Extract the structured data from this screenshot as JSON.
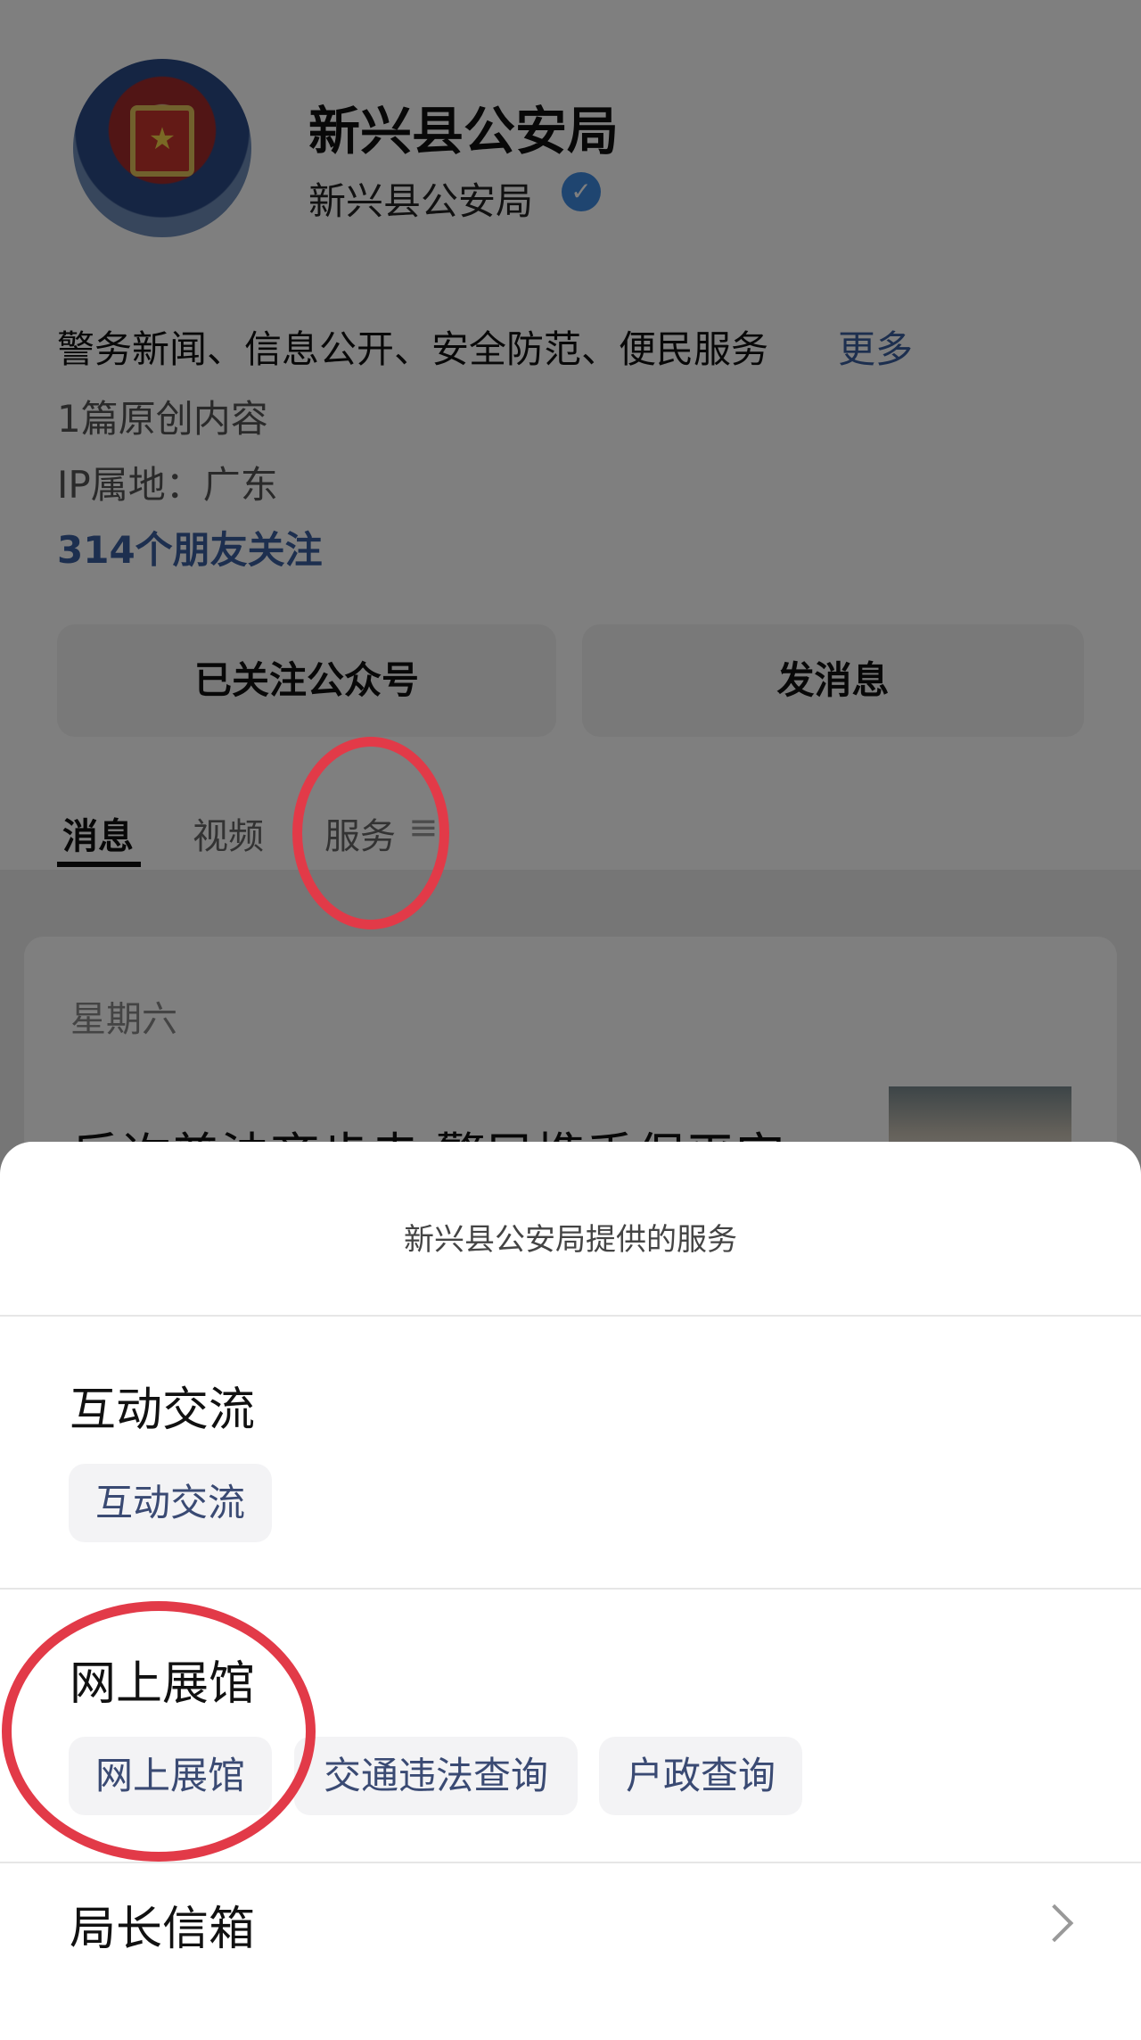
{
  "account": {
    "name": "新兴县公安局",
    "subname": "新兴县公安局",
    "description": "警务新闻、信息公开、安全防范、便民服务",
    "more_link": "更多",
    "original_count": "1篇原创内容",
    "ip_location": "IP属地：广东",
    "friends_following": "314个朋友关注"
  },
  "actions": {
    "follow_label": "已关注公众号",
    "message_label": "发消息"
  },
  "tabs": [
    {
      "label": "消息",
      "active": true
    },
    {
      "label": "视频",
      "active": false
    },
    {
      "label": "服务",
      "active": false
    }
  ],
  "feed": {
    "date": "星期六",
    "title": "反诈普法齐步走 警民携手保平安"
  },
  "services_sheet": {
    "title": "新兴县公安局提供的服务",
    "sections": [
      {
        "title": "互动交流",
        "chips": [
          "互动交流"
        ]
      },
      {
        "title": "网上展馆",
        "chips": [
          "网上展馆",
          "交通违法查询",
          "户政查询"
        ]
      },
      {
        "title": "局长信箱",
        "chips": []
      }
    ]
  },
  "colors": {
    "link_blue": "#3a5f9e",
    "verified_blue": "#3f8ae0",
    "annotation_red": "#e23a48"
  },
  "icons": {
    "verified": "verified-badge-icon",
    "tab_menu": "menu-icon",
    "chevron": "chevron-right-icon"
  }
}
